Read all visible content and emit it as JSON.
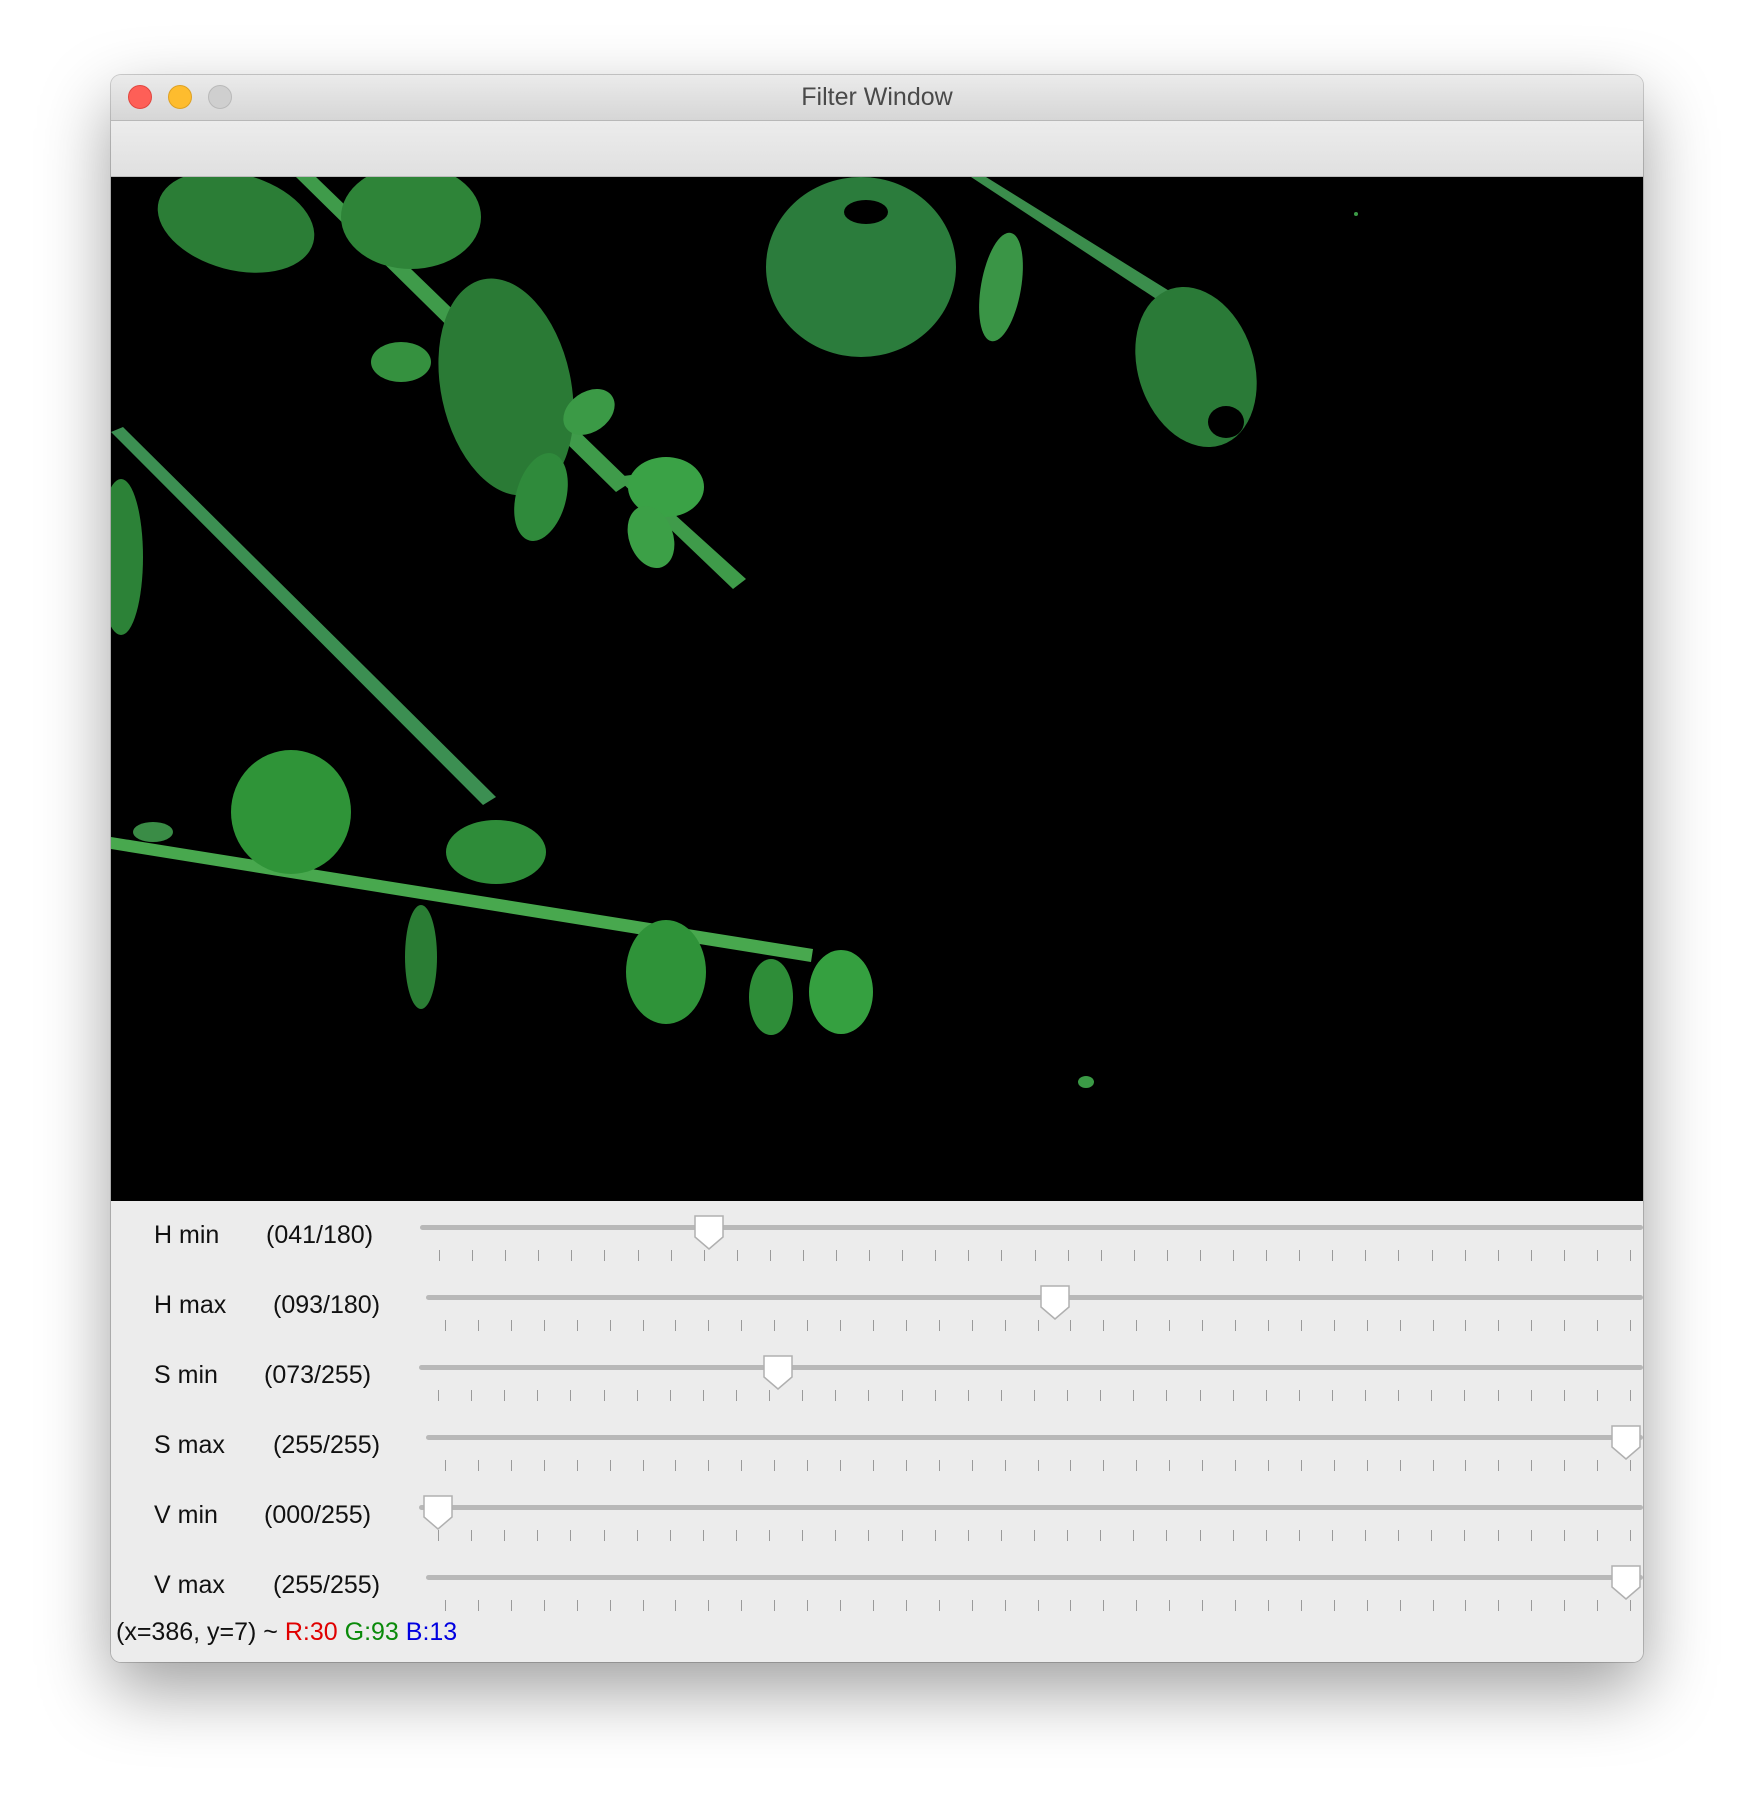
{
  "window": {
    "title": "Filter Window"
  },
  "sliders": [
    {
      "name": "H min",
      "display": "(041/180)",
      "value": 41,
      "max": 180
    },
    {
      "name": "H max",
      "display": "(093/180)",
      "value": 93,
      "max": 180
    },
    {
      "name": "S min",
      "display": "(073/255)",
      "value": 73,
      "max": 255
    },
    {
      "name": "S max",
      "display": "(255/255)",
      "value": 255,
      "max": 255
    },
    {
      "name": "V min",
      "display": "(000/255)",
      "value": 0,
      "max": 255
    },
    {
      "name": "V max",
      "display": "(255/255)",
      "value": 255,
      "max": 255
    }
  ],
  "status": {
    "coords": "(x=386, y=7) ~",
    "r": "R:30",
    "g": "G:93",
    "b": "B:13"
  },
  "colors": {
    "red": "#e00000",
    "green": "#0a8a0a",
    "blue": "#0000e0"
  }
}
